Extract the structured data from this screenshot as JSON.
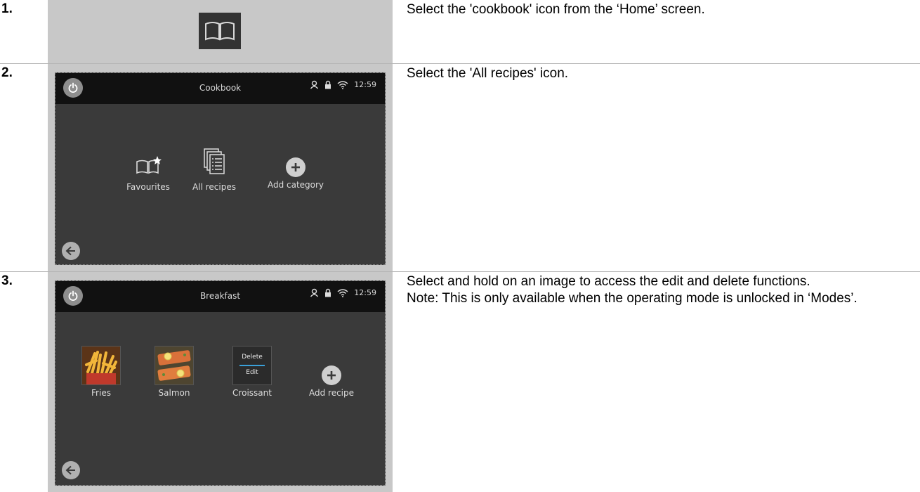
{
  "steps": [
    {
      "number": "1.",
      "description": "Select the 'cookbook' icon from the ‘Home’ screen."
    },
    {
      "number": "2.",
      "description": "Select the 'All recipes' icon.",
      "screen": {
        "title": "Cookbook",
        "time": "12:59",
        "tiles": [
          "Favourites",
          "All recipes",
          "Add category"
        ]
      }
    },
    {
      "number": "3.",
      "description": "Select and hold on an image to access the edit and delete functions.",
      "note": "Note: This is only available when the operating mode is unlocked in ‘Modes’.",
      "screen": {
        "title": "Breakfast",
        "time": "12:59",
        "recipes": [
          "Fries",
          "Salmon",
          "Croissant"
        ],
        "add_label": "Add recipe",
        "menu": {
          "delete": "Delete",
          "edit": "Edit"
        }
      }
    }
  ],
  "icons": [
    "cookbook-icon",
    "power-icon",
    "user-icon",
    "lock-icon",
    "wifi-icon",
    "favourites-icon",
    "all-recipes-icon",
    "plus-icon",
    "back-arrow-icon"
  ],
  "colors": {
    "screen_bg": "#3a3a3a",
    "topbar_bg": "#111111",
    "panel_bg": "#c8c8c8",
    "accent_line": "#3aa0d8"
  }
}
